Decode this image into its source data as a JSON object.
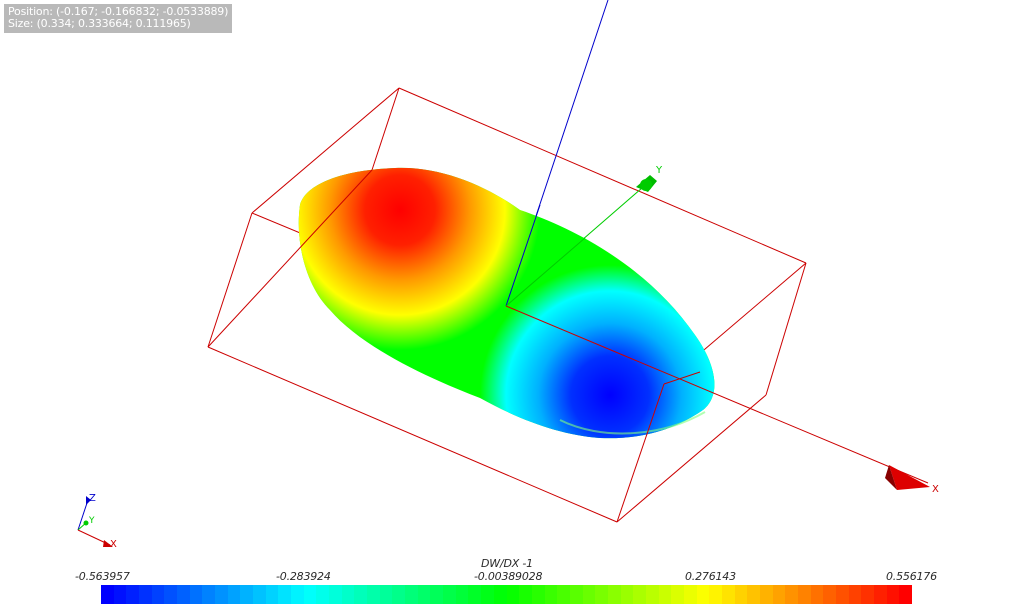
{
  "info": {
    "position": "Position: (-0.167; -0.166832; -0.0533889)",
    "size": "Size: (0.334; 0.333664; 0.111965)"
  },
  "axes": {
    "x_label": "X",
    "y_label": "Y",
    "triad_x": "X",
    "triad_y": "Y",
    "triad_z": "Z"
  },
  "colorbar": {
    "title": "DW/DX -1",
    "ticks": [
      "-0.563957",
      "-0.283924",
      "-0.00389028",
      "0.276143",
      "0.556176"
    ],
    "colors": [
      "#0000ff",
      "#00ffff",
      "#00ff00",
      "#ffff00",
      "#ff0000"
    ],
    "steps": 64
  },
  "colors": {
    "bounding_box": "#cc0000",
    "axis_x": "#cc0000",
    "axis_y": "#00cc00",
    "axis_z": "#0000cc"
  }
}
